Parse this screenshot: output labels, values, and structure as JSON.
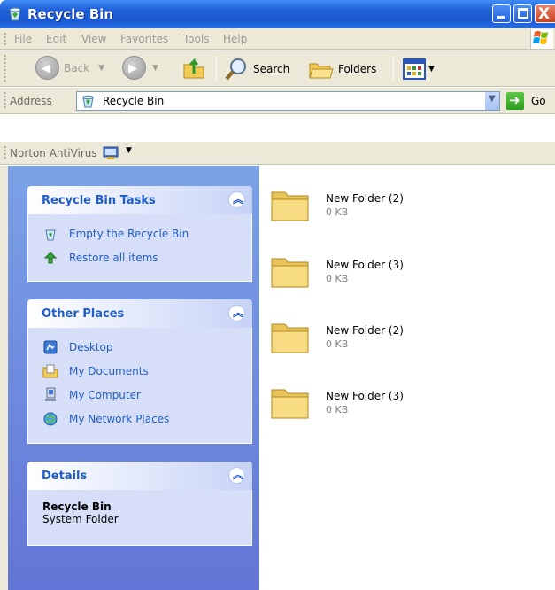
{
  "window": {
    "title": "Recycle Bin",
    "buttons": {
      "close_glyph": "X"
    }
  },
  "menubar": {
    "items": [
      "File",
      "Edit",
      "View",
      "Favorites",
      "Tools",
      "Help"
    ]
  },
  "toolbar": {
    "back_label": "Back",
    "search_label": "Search",
    "folders_label": "Folders"
  },
  "address": {
    "label": "Address",
    "value": "Recycle Bin",
    "go_label": "Go"
  },
  "norton": {
    "label": "Norton AntiVirus"
  },
  "taskpane": {
    "tasks_panel": {
      "title": "Recycle Bin Tasks",
      "items": [
        "Empty the Recycle Bin",
        "Restore all items"
      ]
    },
    "places_panel": {
      "title": "Other Places",
      "items": [
        "Desktop",
        "My Documents",
        "My Computer",
        "My Network Places"
      ]
    },
    "details_panel": {
      "title": "Details",
      "name": "Recycle Bin",
      "type": "System Folder"
    }
  },
  "content": {
    "items": [
      {
        "name": "New Folder (2)",
        "size": "0 KB"
      },
      {
        "name": "New Folder (3)",
        "size": "0 KB"
      },
      {
        "name": "New Folder (2)",
        "size": "0 KB"
      },
      {
        "name": "New Folder (3)",
        "size": "0 KB"
      }
    ]
  },
  "colors": {
    "titlebar": "#1f60d8",
    "taskpane_bg": "#7ba2e7",
    "panel_link": "#215dc6"
  }
}
